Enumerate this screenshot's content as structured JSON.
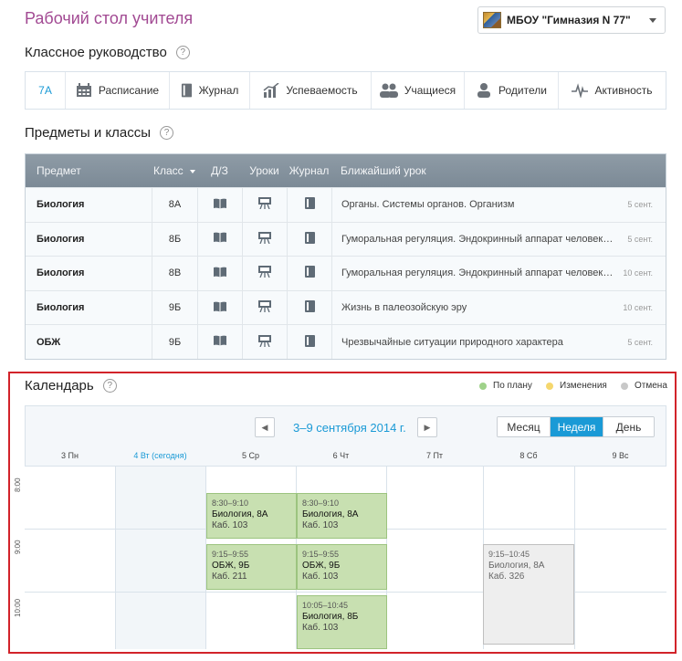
{
  "header": {
    "title": "Рабочий стол учителя",
    "school": "МБОУ \"Гимназия N 77\""
  },
  "class_section": {
    "title": "Классное руководство",
    "help": "?",
    "tabs": [
      {
        "label": "7A",
        "icon": "none"
      },
      {
        "label": "Расписание",
        "icon": "calendar-icon"
      },
      {
        "label": "Журнал",
        "icon": "journal-icon"
      },
      {
        "label": "Успеваемость",
        "icon": "chart-icon"
      },
      {
        "label": "Учащиеся",
        "icon": "students-icon"
      },
      {
        "label": "Родители",
        "icon": "parent-icon"
      },
      {
        "label": "Активность",
        "icon": "activity-icon"
      }
    ]
  },
  "subjects_section": {
    "title": "Предметы и классы",
    "help": "?",
    "columns": {
      "subject": "Предмет",
      "class": "Класс",
      "hw": "Д/З",
      "lessons": "Уроки",
      "journal": "Журнал",
      "next": "Ближайший урок"
    },
    "rows": [
      {
        "subject": "Биология",
        "class": "8А",
        "next": "Органы. Системы органов. Организм",
        "date": "5 сент."
      },
      {
        "subject": "Биология",
        "class": "8Б",
        "next": "Гуморальная регуляция. Эндокринный аппарат человека, ег...",
        "date": "5 сент."
      },
      {
        "subject": "Биология",
        "class": "8В",
        "next": "Гуморальная регуляция. Эндокринный аппарат человека, ег...",
        "date": "10 сент."
      },
      {
        "subject": "Биология",
        "class": "9Б",
        "next": "Жизнь в палеозойскую эру",
        "date": "10 сент."
      },
      {
        "subject": "ОБЖ",
        "class": "9Б",
        "next": "Чрезвычайные ситуации природного характера",
        "date": "5 сент."
      }
    ]
  },
  "calendar": {
    "title": "Календарь",
    "help": "?",
    "legend": [
      {
        "label": "По плану",
        "color": "#9fd28a"
      },
      {
        "label": "Изменения",
        "color": "#f5d76e"
      },
      {
        "label": "Отмена",
        "color": "#c8c8c8"
      }
    ],
    "prev": "◀",
    "next": "▶",
    "week": "3–9 сентября 2014 г.",
    "views": [
      "Месяц",
      "Неделя",
      "День"
    ],
    "active_view": "Неделя",
    "days": [
      "3 Пн",
      "4 Вт (сегодня)",
      "5 Ср",
      "6 Чт",
      "7 Пт",
      "8 Сб",
      "9 Вс"
    ],
    "times": [
      "8:00",
      "9:00",
      "10:00"
    ],
    "events": [
      {
        "time": "8:30–9:10",
        "subject": "Биология, 8А",
        "room": "Каб. 103"
      },
      {
        "time": "8:30–9:10",
        "subject": "Биология, 8А",
        "room": "Каб. 103"
      },
      {
        "time": "9:15–9:55",
        "subject": "ОБЖ, 9Б",
        "room": "Каб. 211"
      },
      {
        "time": "9:15–9:55",
        "subject": "ОБЖ, 9Б",
        "room": "Каб. 103"
      },
      {
        "time": "10:05–10:45",
        "subject": "Биология, 8Б",
        "room": "Каб. 103"
      },
      {
        "time": "9:15–10:45",
        "subject": "Биология, 8А",
        "room": "Каб. 326"
      }
    ]
  }
}
